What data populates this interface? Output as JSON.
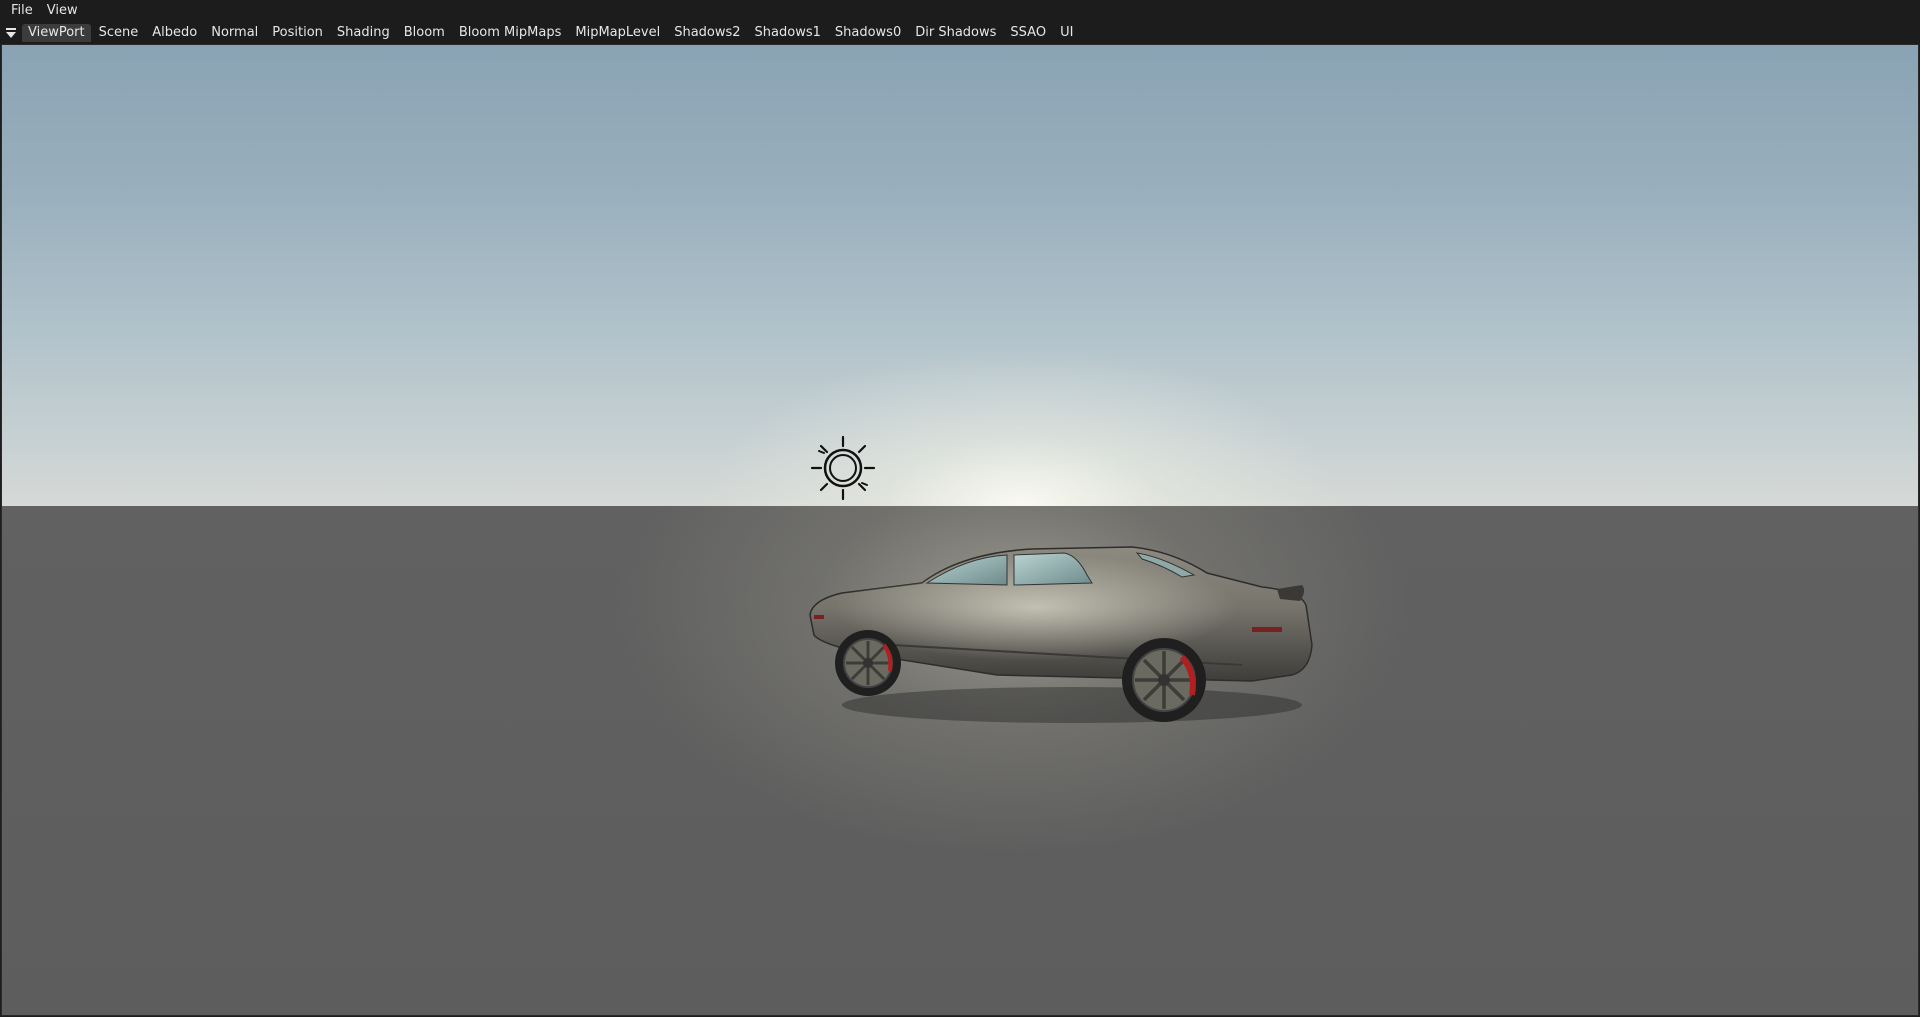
{
  "menubar": {
    "items": [
      {
        "label": "File"
      },
      {
        "label": "View"
      }
    ]
  },
  "tabbar": {
    "dropdown_icon": "triangle-down-icon",
    "active_tab": "ViewPort",
    "tabs": [
      {
        "label": "ViewPort"
      },
      {
        "label": "Scene"
      },
      {
        "label": "Albedo"
      },
      {
        "label": "Normal"
      },
      {
        "label": "Position"
      },
      {
        "label": "Shading"
      },
      {
        "label": "Bloom"
      },
      {
        "label": "Bloom MipMaps"
      },
      {
        "label": "MipMapLevel"
      },
      {
        "label": "Shadows2"
      },
      {
        "label": "Shadows1"
      },
      {
        "label": "Shadows0"
      },
      {
        "label": "Dir Shadows"
      },
      {
        "label": "SSAO"
      },
      {
        "label": "UI"
      }
    ]
  },
  "viewport": {
    "light_gizmo_icon": "sun-icon",
    "scene_object": "car-model",
    "colors": {
      "sky_top": "#8aa3b4",
      "horizon": "#d6d9d6",
      "ground": "#616161",
      "car_body": "#6e6c66",
      "brake_caliper": "#b02020"
    }
  }
}
